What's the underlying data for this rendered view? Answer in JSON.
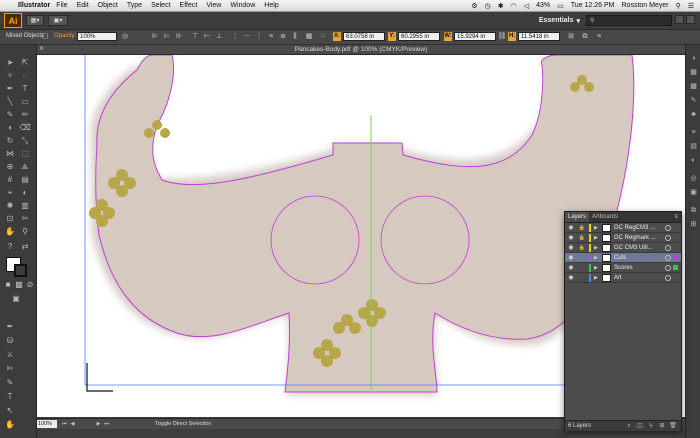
{
  "menubar": {
    "app_name": "Illustrator",
    "items": [
      "File",
      "Edit",
      "Object",
      "Type",
      "Select",
      "Effect",
      "View",
      "Window",
      "Help"
    ],
    "battery": "43%",
    "clock": "Tue 12:26 PM",
    "user": "Rosston Meyer"
  },
  "appbar": {
    "logo": "Ai",
    "workspace": "Essentials"
  },
  "controlbar": {
    "selection_label": "Mixed Objects",
    "opacity_label": "Opacity:",
    "opacity_value": "100%",
    "x_label": "X:",
    "x_value": "63.0758 in",
    "y_label": "Y:",
    "y_value": "60.2955 in",
    "w_label": "W:",
    "w_value": "15.9294 in",
    "h_label": "H:",
    "h_value": "11.5418 in"
  },
  "document": {
    "title": "Pancakes-Body.pdf @ 100% (CMYK/Preview)"
  },
  "status": {
    "zoom": "100%",
    "text": "Toggle Direct Selection"
  },
  "layers_panel": {
    "tabs": [
      "Layers",
      "Artboards"
    ],
    "layers": [
      {
        "name": "GC RegCM3 ...",
        "color": "#e8d400",
        "locked": true,
        "selected": false
      },
      {
        "name": "GC Regmark ...",
        "color": "#e8d400",
        "locked": true,
        "selected": false
      },
      {
        "name": "GC CM3 Util...",
        "color": "#e8d400",
        "locked": true,
        "selected": false
      },
      {
        "name": "Cuts",
        "color": "#9b59d6",
        "locked": false,
        "selected": true
      },
      {
        "name": "Scores",
        "color": "#2ecc40",
        "locked": false,
        "selected": false
      },
      {
        "name": "Art",
        "color": "#4a8cff",
        "locked": false,
        "selected": false
      }
    ],
    "count": "6 Layers"
  },
  "colors": {
    "accent": "#ff9a00",
    "cut_path": "#c040d0",
    "score_line": "#7fd34a",
    "artboard": "#4a7cff",
    "body_fill": "#d6c9c0"
  }
}
